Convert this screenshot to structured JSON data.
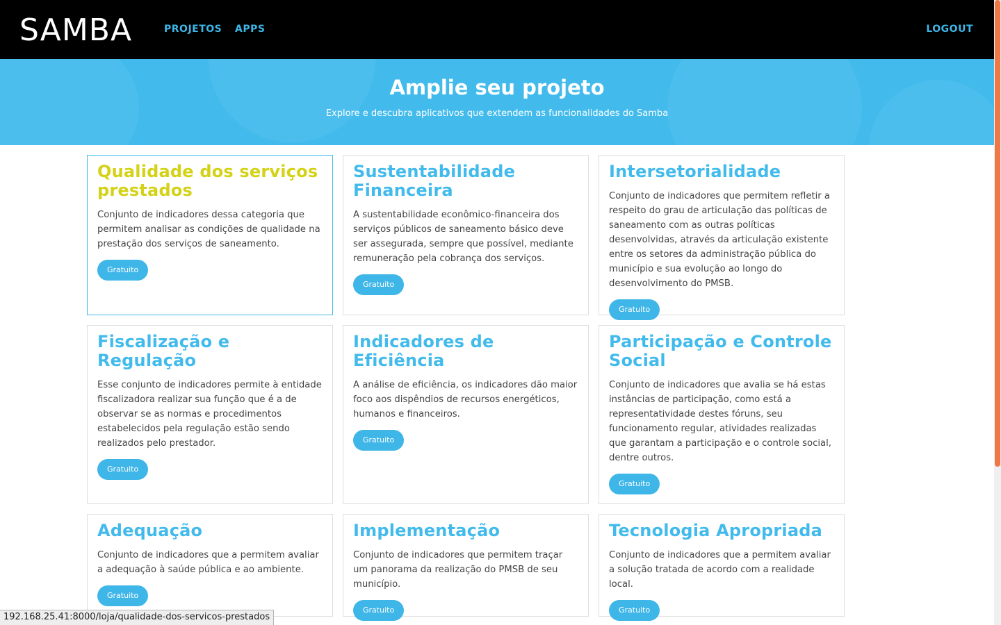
{
  "navbar": {
    "logo": "SAMBA",
    "links": {
      "projetos": "PROJETOS",
      "apps": "APPS",
      "logout": "LOGOUT"
    }
  },
  "hero": {
    "title": "Amplie seu projeto",
    "subtitle": "Explore e descubra aplicativos que extendem as funcionalidades do Samba"
  },
  "cards": [
    {
      "title": "Qualidade dos serviços prestados",
      "description": "Conjunto de indicadores dessa categoria que permitem analisar as condições de qualidade na prestação dos serviços de saneamento.",
      "badge": "Gratuito"
    },
    {
      "title": "Sustentabilidade Financeira",
      "description": "A sustentabilidade econômico-financeira dos serviços públicos de saneamento básico deve ser assegurada, sempre que possível, mediante remuneração pela cobrança dos serviços.",
      "badge": "Gratuito"
    },
    {
      "title": "Intersetorialidade",
      "description": "Conjunto de indicadores que permitem refletir a respeito do grau de articulação das políticas de saneamento com as outras políticas desenvolvidas, através da articulação existente entre os setores da administração pública do município e sua evolução ao longo do desenvolvimento do PMSB.",
      "badge": "Gratuito"
    },
    {
      "title": "Fiscalização e Regulação",
      "description": "Esse conjunto de indicadores permite à entidade fiscalizadora realizar sua função que é a de observar se as normas e procedimentos estabelecidos pela regulação estão sendo realizados pelo prestador.",
      "badge": "Gratuito"
    },
    {
      "title": "Indicadores de Eficiência",
      "description": "A análise de eficiência, os indicadores dão maior foco aos dispêndios de recursos energéticos, humanos e financeiros.",
      "badge": "Gratuito"
    },
    {
      "title": "Participação e Controle Social",
      "description": "Conjunto de indicadores que avalia se há estas instâncias de participação, como está a representatividade destes fóruns, seu funcionamento regular, atividades realizadas que garantam a participação e o controle social, dentre outros.",
      "badge": "Gratuito"
    },
    {
      "title": "Adequação",
      "description": "Conjunto de indicadores que a permitem avaliar a adequação à saúde pública e ao ambiente.",
      "badge": "Gratuito"
    },
    {
      "title": "Implementação",
      "description": "Conjunto de indicadores que permitem traçar um panorama da realização do PMSB de seu município.",
      "badge": "Gratuito"
    },
    {
      "title": "Tecnologia Apropriada",
      "description": "Conjunto de indicadores que a permitem avaliar a solução tratada de acordo com a realidade local.",
      "badge": "Gratuito"
    }
  ],
  "status_bar": {
    "url": "192.168.25.41:8000/loja/qualidade-dos-servicos-prestados"
  },
  "colors": {
    "accent": "#42bbec",
    "selected_title": "#d4d217",
    "navbar": "#000000",
    "scroll_thumb": "#f07746"
  }
}
